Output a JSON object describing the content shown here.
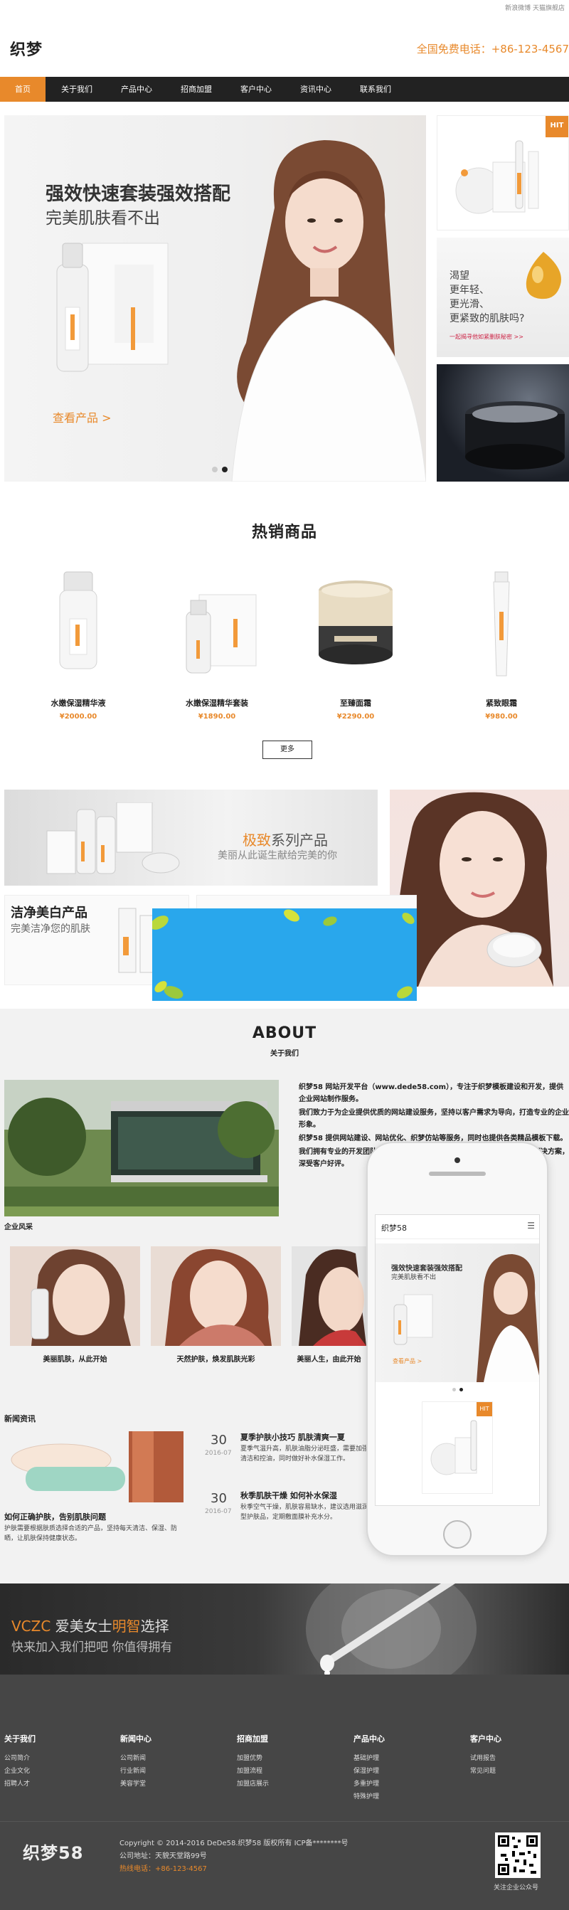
{
  "header": {
    "top_links": "新浪微博  天猫旗舰店",
    "logo": "织梦",
    "hotline": "全国免费电话：+86-123-4567"
  },
  "nav": {
    "items": [
      {
        "label": "首页",
        "active": true
      },
      {
        "label": "关于我们"
      },
      {
        "label": "产品中心"
      },
      {
        "label": "招商加盟"
      },
      {
        "label": "客户中心"
      },
      {
        "label": "资讯中心"
      },
      {
        "label": "联系我们"
      }
    ]
  },
  "hero": {
    "title": "强效快速套装强效搭配",
    "subtitle": "完美肌肤看不出",
    "link": "查看产品 >"
  },
  "side_cards": {
    "hit": "HIT",
    "card2_lines": [
      "渴望",
      "更年轻、",
      "更光滑、",
      "更紧致的肌肤吗?"
    ],
    "card2_link": "一起揭寻他如紧删肤秘密 >>"
  },
  "featured": {
    "title": "热销商品",
    "products": [
      {
        "name": "水嫩保湿精华液",
        "price": "¥2000.00"
      },
      {
        "name": "水嫩保湿精华套装",
        "price": "¥1890.00"
      },
      {
        "name": "至臻面霜",
        "price": "¥2290.00"
      },
      {
        "name": "紧致眼霜",
        "price": "¥980.00"
      }
    ],
    "more": "更多"
  },
  "banners": {
    "series_brand": "极致",
    "series_rest": "系列产品",
    "series_sub": "美丽从此诞生献给完美的你",
    "clean_title": "洁净美白产品",
    "clean_sub": "完美洁净您的肌肤"
  },
  "about": {
    "title": "ABOUT",
    "subtitle": "关于我们",
    "paragraphs": [
      "织梦58 网站开发平台（www.dede58.com），专注于织梦模板建设和开发，提供企业网站制作服务。",
      "我们致力于为企业提供优质的网站建设服务，坚持以客户需求为导向，打造专业的企业形象。",
      "织梦58 提供网站建设、网站优化、织梦仿站等服务，同时也提供各类精品模板下载。",
      "我们拥有专业的开发团队，多年建站经验，为众多企业提供了完善的互联网解决方案，深受客户好评。"
    ],
    "image_caption": "企业风采",
    "gallery": [
      "美丽肌肤，从此开始",
      "天然护肤，焕发肌肤光彩",
      "美丽人生，由此开始"
    ]
  },
  "news": {
    "heading": "新闻资讯",
    "feature_title": "如何正确护肤，告别肌肤问题",
    "feature_text": "护肤需要根据肤质选择合适的产品，坚持每天清洁、保湿、防晒，让肌肤保持健康状态。",
    "items": [
      {
        "day": "30",
        "month": "2016-07",
        "title": "夏季护肤小技巧 肌肤清爽一夏",
        "text": "夏季气温升高，肌肤油脂分泌旺盛，需要加强清洁和控油，同时做好补水保湿工作。"
      },
      {
        "day": "30",
        "month": "2016-07",
        "title": "秋季肌肤干燥 如何补水保湿",
        "text": "秋季空气干燥，肌肤容易缺水，建议选用滋润型护肤品，定期敷面膜补充水分。"
      }
    ]
  },
  "phone": {
    "logo": "织梦58",
    "title": "强效快速套装强效搭配",
    "subtitle": "完美肌肤看不出",
    "link": "查看产品 >",
    "hit": "HIT"
  },
  "cta": {
    "brand": "VCZC",
    "middle": "爱美女士",
    "highlight": "明智",
    "end": "选择",
    "sub": "快来加入我们把吧 你值得拥有"
  },
  "footer": {
    "columns": [
      {
        "title": "关于我们",
        "items": [
          "公司简介",
          "企业文化",
          "招聘人才"
        ]
      },
      {
        "title": "新闻中心",
        "items": [
          "公司新闻",
          "行业新闻",
          "美容学堂"
        ]
      },
      {
        "title": "招商加盟",
        "items": [
          "加盟优势",
          "加盟流程",
          "加盟店展示"
        ]
      },
      {
        "title": "产品中心",
        "items": [
          "基础护理",
          "保湿护理",
          "多重护理",
          "特殊护理"
        ]
      },
      {
        "title": "客户中心",
        "items": [
          "试用报告",
          "常见问题"
        ]
      }
    ],
    "logo": "织梦58",
    "copyright": "Copyright © 2014-2016 DeDe58.织梦58 版权所有 ICP备********号",
    "address": "公司地址：天貌天堂路99号",
    "phone": "热线电话：+86-123-4567",
    "qr_label": "关注企业公众号"
  },
  "colors": {
    "accent": "#e8892b",
    "nav_bg": "#222222",
    "footer_bg": "#464646",
    "about_bg": "#f2f2f2"
  }
}
